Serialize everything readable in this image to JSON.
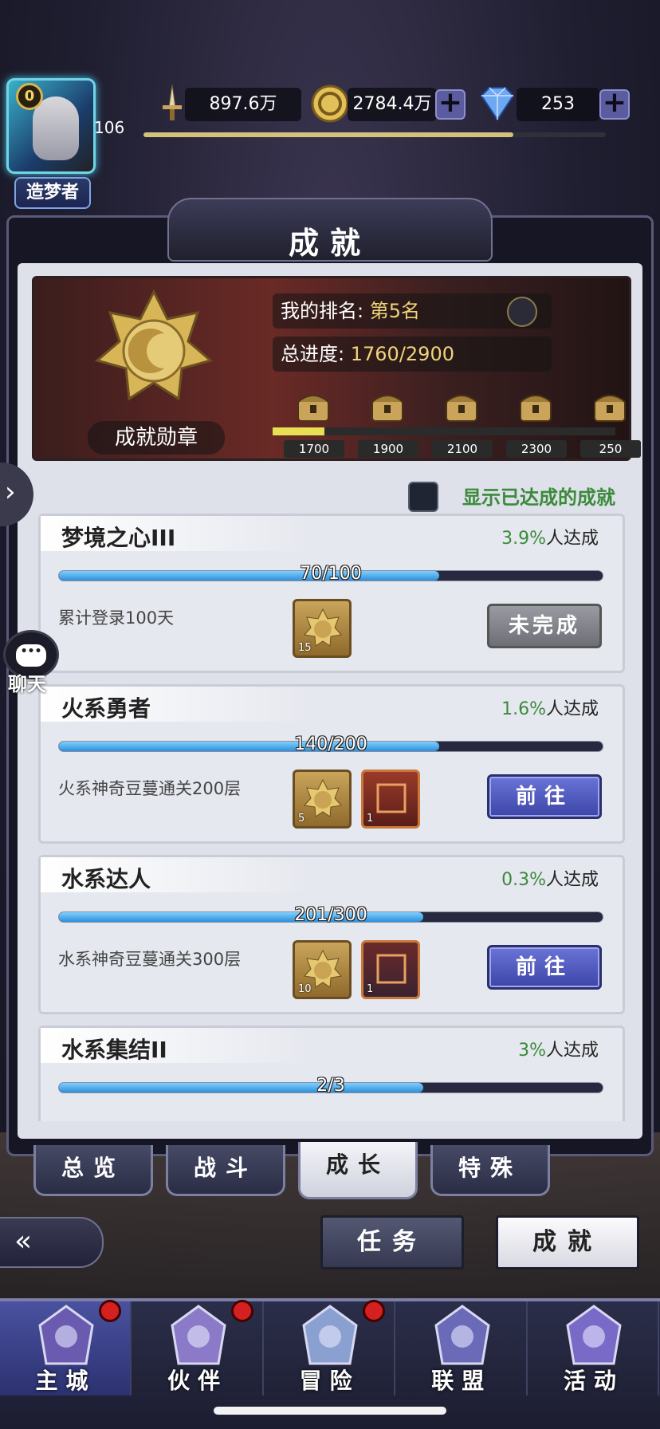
{
  "player": {
    "vip": "0",
    "level": "106",
    "title": "造梦者"
  },
  "resources": {
    "power": "897.6万",
    "gold": "2784.4万",
    "gems": "253"
  },
  "panel": {
    "title": "成就",
    "medal_label": "成就勋章",
    "rank_label": "我的排名:",
    "rank_value": "第5名",
    "progress_label": "总进度:",
    "progress_value": "1760/2900",
    "milestones": [
      "1700",
      "1900",
      "2100",
      "2300",
      "250"
    ],
    "milestone_progress": 0.15,
    "show_completed_label": "显示已达成的成就"
  },
  "achievements": [
    {
      "name": "梦境之心III",
      "pct": "3.9%",
      "pct_suffix": "人达成",
      "progress": "70/100",
      "fill": 0.7,
      "desc": "累计登录100天",
      "rewards": [
        {
          "count": "15",
          "type": "medal"
        }
      ],
      "button": "未完成",
      "button_style": "grey"
    },
    {
      "name": "火系勇者",
      "pct": "1.6%",
      "pct_suffix": "人达成",
      "progress": "140/200",
      "fill": 0.7,
      "desc": "火系神奇豆蔓通关200层",
      "rewards": [
        {
          "count": "5",
          "type": "medal"
        },
        {
          "count": "1",
          "type": "fire-frame"
        }
      ],
      "button": "前往",
      "button_style": "blue"
    },
    {
      "name": "水系达人",
      "pct": "0.3%",
      "pct_suffix": "人达成",
      "progress": "201/300",
      "fill": 0.67,
      "desc": "水系神奇豆蔓通关300层",
      "rewards": [
        {
          "count": "10",
          "type": "medal"
        },
        {
          "count": "1",
          "type": "water-frame"
        }
      ],
      "button": "前往",
      "button_style": "blue"
    },
    {
      "name": "水系集结II",
      "pct": "3%",
      "pct_suffix": "人达成",
      "progress": "2/3",
      "fill": 0.67,
      "desc": "",
      "rewards": [],
      "button": "",
      "button_style": "blue"
    }
  ],
  "tabs": [
    "总览",
    "战斗",
    "成长",
    "特殊"
  ],
  "active_tab": "成长",
  "switches": {
    "task": "任务",
    "achievement": "成就"
  },
  "chat": "聊天",
  "nav": [
    "主城",
    "伙伴",
    "冒险",
    "联盟",
    "活动"
  ],
  "colors": {
    "accent": "#3d45a8",
    "progress": "#2e8fd8",
    "green": "#3b8a3b"
  }
}
